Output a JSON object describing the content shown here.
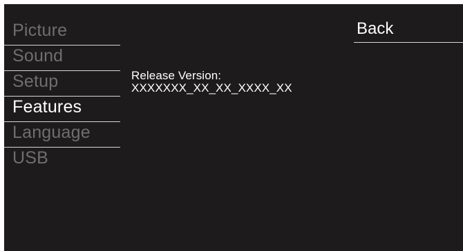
{
  "menu": {
    "items": [
      {
        "label": "Picture",
        "active": false
      },
      {
        "label": "Sound",
        "active": false
      },
      {
        "label": "Setup",
        "active": false
      },
      {
        "label": "Features",
        "active": true
      },
      {
        "label": "Language",
        "active": false
      },
      {
        "label": "USB",
        "active": false
      }
    ]
  },
  "info": {
    "release_label": "Release Version:",
    "release_value": "XXXXXXX_XX_XX_XXXX_XX"
  },
  "back_label": "Back",
  "colors": {
    "background": "#1d1b1b",
    "active_text": "#ffffff",
    "inactive_text": "#6f6f6f",
    "divider": "#d9d9d9"
  }
}
